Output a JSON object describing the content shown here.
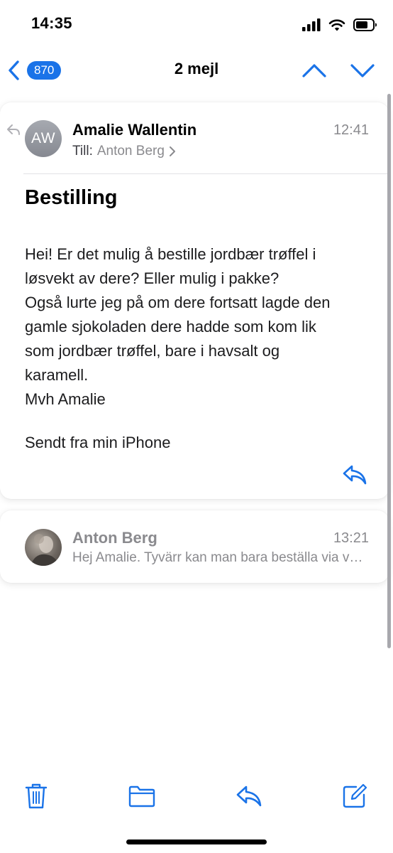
{
  "status_bar": {
    "time": "14:35"
  },
  "nav": {
    "unread_count": "870",
    "title": "2 mejl"
  },
  "messages": [
    {
      "avatar_initials": "AW",
      "sender": "Amalie Wallentin",
      "to_label": "Till:",
      "to_name": "Anton Berg",
      "time": "12:41",
      "subject": "Bestilling",
      "body_lines": [
        "Hei! Er det mulig å bestille jordbær trøffel i",
        "løsvekt av dere? Eller mulig i pakke?",
        "Også lurte jeg på om dere fortsatt lagde den",
        "gamle sjokoladen dere hadde som kom lik",
        "som jordbær trøffel, bare i havsalt og",
        "karamell.",
        "Mvh Amalie"
      ],
      "signature": "Sendt fra min iPhone"
    },
    {
      "sender": "Anton Berg",
      "time": "13:21",
      "preview": "Hej Amalie. Tyvärr kan man bara beställa via vår webbshop."
    }
  ],
  "theme": {
    "accent": "#1a73e8",
    "secondary_text": "#8a8a8e"
  },
  "icons": {
    "back": "chevron-left-icon",
    "previous": "chevron-up-icon",
    "next": "chevron-down-icon",
    "reply": "reply-icon",
    "trash": "trash-icon",
    "folder": "folder-icon",
    "compose": "compose-icon"
  }
}
